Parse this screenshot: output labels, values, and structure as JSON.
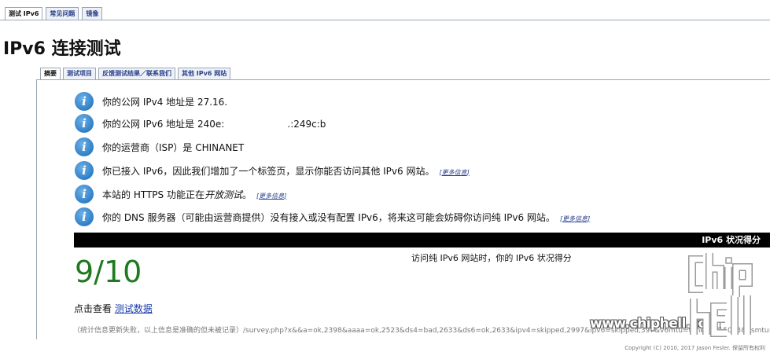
{
  "top_tabs": [
    "测试 IPv6",
    "常见问题",
    "镜像"
  ],
  "page": {
    "title": "IPv6 连接测试"
  },
  "sub_tabs": [
    "摘要",
    "测试项目",
    "反馈测试结果／联系我们",
    "其他 IPv6 网站"
  ],
  "info": {
    "row1": "你的公网 IPv4 地址是 27.16.",
    "row2": "你的公网 IPv6 地址是 240e:                     .:249c:b",
    "row3": "你的运营商（ISP）是 CHINANET",
    "row4": "你已接入 IPv6，因此我们增加了一个标签页，显示你能否访问其他 IPv6 网站。",
    "row5_before": "本站的 HTTPS 功能正在",
    "row5_em": "开放测试",
    "row5_after": "。",
    "row6": "你的 DNS 服务器（可能由运营商提供）没有接入或没有配置 IPv6，将来这可能会妨碍你访问纯 IPv6 网站。",
    "more_label": "更多信息",
    "icon": "info-icon",
    "icon_glyph": "i"
  },
  "score": {
    "bar_label": "IPv6 状况得分",
    "caption": "访问纯 IPv6 网站时，你的 IPv6 状况得分",
    "value": "9/10",
    "color": "#1f7a1f"
  },
  "view_data": {
    "prefix": "点击查看 ",
    "link": "测试数据"
  },
  "stats_note": "（统计信息更新失败，以上信息是准确的但未被记录）/survey.php?x&&a=ok,2398&aaaa=ok,2523&ds4=bad,2633&ds6=ok,2633&ipv4=skipped,2997&ipv6=skipped,397&v6mtu=timeout,15063&dsmtu=ok,31...",
  "copyright": "Copyright (C) 2010, 2017 Jason Fesler. 保留所有权利",
  "watermark": {
    "url": "www.chiphell.com",
    "logo_top": "chip",
    "logo_bottom": "hell"
  }
}
